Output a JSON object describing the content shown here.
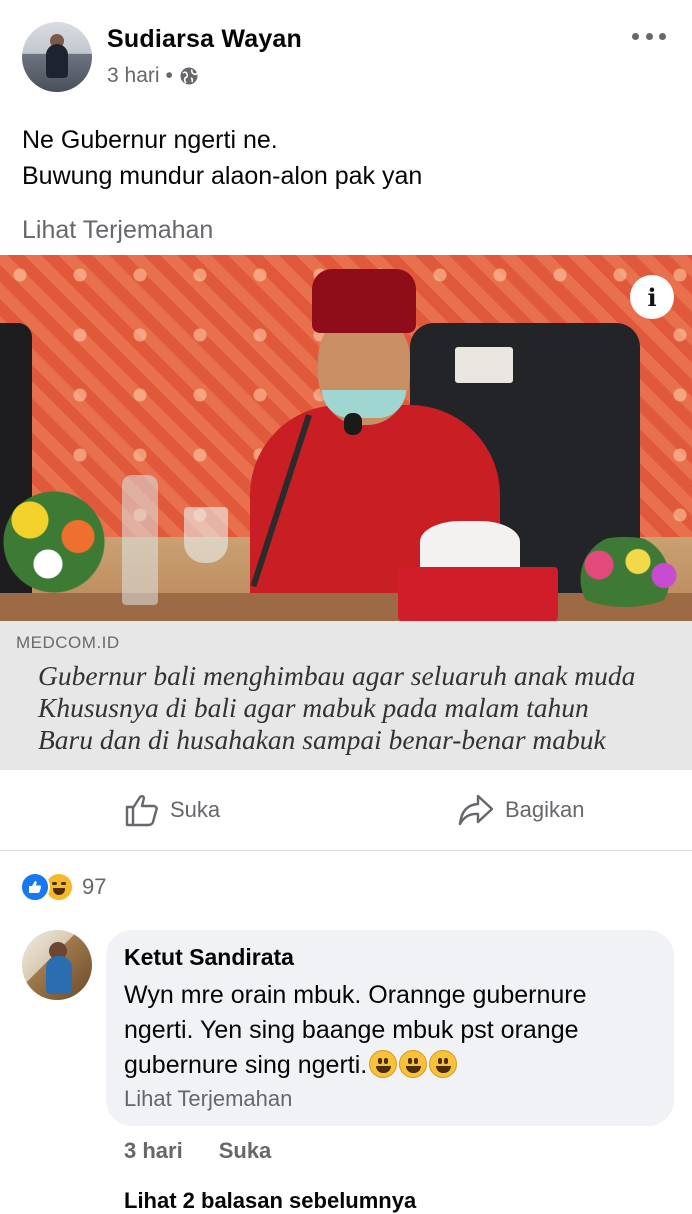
{
  "post": {
    "author": "Sudiarsa Wayan",
    "time": "3 hari",
    "separator": "•",
    "privacy_icon": "globe-icon",
    "text_lines": [
      "Ne Gubernur ngerti ne.",
      "Buwung mundur alaon-alon pak yan"
    ],
    "see_translation": "Lihat Terjemahan"
  },
  "image": {
    "source": "MEDCOM.ID",
    "caption_lines": [
      "Gubernur bali menghimbau agar seluaruh anak muda",
      "Khususnya di bali agar mabuk pada malam tahun",
      "Baru dan di husahakan sampai benar-benar mabuk"
    ],
    "info_symbol": "i"
  },
  "actions": {
    "like": "Suka",
    "share": "Bagikan"
  },
  "reactions": {
    "count": "97",
    "icons": [
      "like-icon",
      "haha-icon"
    ],
    "like_color": "#1877f2",
    "haha_color": "#f7b928"
  },
  "comment": {
    "name": "Ketut Sandirata",
    "text_lines": [
      "Wyn mre orain mbuk. Orannge gubernure",
      "ngerti.  Yen sing baange mbuk pst orange",
      "gubernure sing ngerti."
    ],
    "emoji_count": 3,
    "see_translation": "Lihat Terjemahan",
    "time": "3 hari",
    "like": "Suka"
  },
  "replies": {
    "label": "Lihat 2 balasan sebelumnya"
  }
}
